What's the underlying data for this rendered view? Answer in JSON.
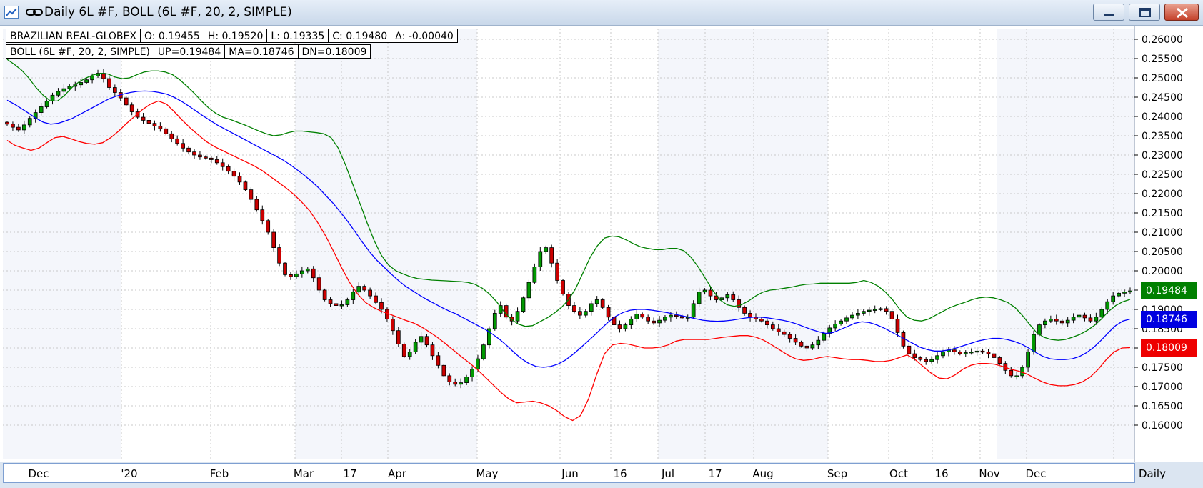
{
  "window": {
    "title": "Daily 6L #F, BOLL (6L #F, 20, 2, SIMPLE)",
    "icons": [
      "chart-app-icon",
      "link-icon",
      "minimize-icon",
      "maximize-icon",
      "close-icon"
    ]
  },
  "info_bar": {
    "row1": [
      "BRAZILIAN REAL-GLOBEX",
      "O: 0.19455",
      "H: 0.19520",
      "L: 0.19335",
      "C: 0.19480",
      "Δ: -0.00040"
    ],
    "row2": [
      "BOLL (6L #F, 20, 2, SIMPLE)",
      "UP=0.19484",
      "MA=0.18746",
      "DN=0.18009"
    ]
  },
  "price_tags": [
    {
      "label": "0.19484",
      "color": "#008000",
      "value": 0.19484
    },
    {
      "label": "0.18746",
      "color": "#0000e0",
      "value": 0.18746
    },
    {
      "label": "0.18009",
      "color": "#ee0000",
      "value": 0.18009
    }
  ],
  "period_label": "Daily",
  "chart_data": {
    "type": "candlestick",
    "y_ticks": [
      "0.26000",
      "0.25500",
      "0.25000",
      "0.24500",
      "0.24000",
      "0.23500",
      "0.23000",
      "0.22500",
      "0.22000",
      "0.21500",
      "0.21000",
      "0.20500",
      "0.20000",
      "0.19500",
      "0.19000",
      "0.18500",
      "0.18000",
      "0.17500",
      "0.17000",
      "0.16500",
      "0.16000"
    ],
    "ylim": [
      0.1595,
      0.2625
    ],
    "x_labels": [
      "Dec",
      "'20",
      "Feb",
      "Mar",
      "17",
      "Apr",
      "May",
      "Jun",
      "16",
      "Jul",
      "17",
      "Aug",
      "Sep",
      "Oct",
      "16",
      "Nov",
      "Dec"
    ],
    "grid": true,
    "colors": {
      "up": "#009900",
      "down": "#cc0000",
      "upper_band": "#008000",
      "mid_band": "#0000ff",
      "lower_band": "#ff0000"
    },
    "close": [
      0.238,
      0.2372,
      0.2365,
      0.2378,
      0.2395,
      0.241,
      0.2425,
      0.244,
      0.2455,
      0.2465,
      0.2472,
      0.2478,
      0.2482,
      0.2488,
      0.2495,
      0.2505,
      0.2512,
      0.2498,
      0.2475,
      0.2462,
      0.2448,
      0.243,
      0.2412,
      0.2398,
      0.239,
      0.2382,
      0.2375,
      0.2368,
      0.2355,
      0.2342,
      0.233,
      0.2318,
      0.2308,
      0.23,
      0.2295,
      0.2292,
      0.2288,
      0.228,
      0.227,
      0.2258,
      0.2245,
      0.223,
      0.221,
      0.2185,
      0.2158,
      0.213,
      0.21,
      0.206,
      0.202,
      0.199,
      0.1985,
      0.1992,
      0.2,
      0.2005,
      0.1982,
      0.195,
      0.1925,
      0.1915,
      0.191,
      0.1912,
      0.1925,
      0.1945,
      0.196,
      0.195,
      0.1935,
      0.1918,
      0.19,
      0.1875,
      0.1845,
      0.181,
      0.1778,
      0.179,
      0.1815,
      0.183,
      0.1808,
      0.178,
      0.1755,
      0.1728,
      0.1712,
      0.1706,
      0.171,
      0.1725,
      0.1745,
      0.1772,
      0.1808,
      0.185,
      0.189,
      0.191,
      0.188,
      0.187,
      0.1895,
      0.193,
      0.197,
      0.201,
      0.205,
      0.206,
      0.202,
      0.1975,
      0.194,
      0.191,
      0.1895,
      0.1885,
      0.1895,
      0.1915,
      0.1925,
      0.1905,
      0.188,
      0.186,
      0.185,
      0.186,
      0.1875,
      0.1888,
      0.188,
      0.187,
      0.1865,
      0.1872,
      0.188,
      0.1885,
      0.1882,
      0.1878,
      0.188,
      0.1915,
      0.1945,
      0.195,
      0.1935,
      0.1925,
      0.193,
      0.1938,
      0.1925,
      0.1905,
      0.189,
      0.188,
      0.1875,
      0.187,
      0.186,
      0.185,
      0.1842,
      0.1835,
      0.1825,
      0.1815,
      0.1805,
      0.18,
      0.1808,
      0.182,
      0.1838,
      0.1852,
      0.1862,
      0.187,
      0.1878,
      0.1885,
      0.189,
      0.1895,
      0.1898,
      0.19,
      0.1902,
      0.1895,
      0.1875,
      0.184,
      0.1805,
      0.1785,
      0.1775,
      0.177,
      0.1765,
      0.177,
      0.178,
      0.179,
      0.1795,
      0.179,
      0.1785,
      0.1788,
      0.179,
      0.1792,
      0.179,
      0.1785,
      0.1775,
      0.176,
      0.1742,
      0.1728,
      0.1728,
      0.175,
      0.179,
      0.1835,
      0.186,
      0.187,
      0.1875,
      0.187,
      0.1865,
      0.1872,
      0.188,
      0.1885,
      0.1878,
      0.187,
      0.188,
      0.19,
      0.192,
      0.1935,
      0.1942,
      0.1945,
      0.1948
    ],
    "upper_band": [
      0.2548,
      0.2535,
      0.252,
      0.25,
      0.2475,
      0.2455,
      0.244,
      0.244,
      0.2455,
      0.2475,
      0.249,
      0.25,
      0.2508,
      0.2512,
      0.251,
      0.2502,
      0.2498,
      0.25,
      0.2508,
      0.2515,
      0.2518,
      0.2518,
      0.2515,
      0.2508,
      0.2495,
      0.2478,
      0.246,
      0.244,
      0.2422,
      0.2408,
      0.2398,
      0.2392,
      0.2385,
      0.2378,
      0.237,
      0.2362,
      0.2355,
      0.235,
      0.2352,
      0.2358,
      0.2362,
      0.2362,
      0.236,
      0.2358,
      0.2355,
      0.2345,
      0.2318,
      0.2275,
      0.2225,
      0.2175,
      0.2125,
      0.2078,
      0.204,
      0.2015,
      0.2,
      0.1992,
      0.1985,
      0.198,
      0.1978,
      0.1976,
      0.1975,
      0.1974,
      0.1973,
      0.1972,
      0.197,
      0.1965,
      0.1955,
      0.194,
      0.192,
      0.1895,
      0.1875,
      0.1862,
      0.1856,
      0.1858,
      0.1868,
      0.1878,
      0.189,
      0.1905,
      0.1925,
      0.1955,
      0.1995,
      0.2035,
      0.2065,
      0.2085,
      0.209,
      0.2088,
      0.208,
      0.207,
      0.2062,
      0.2058,
      0.2055,
      0.2055,
      0.2058,
      0.2058,
      0.2052,
      0.2035,
      0.201,
      0.198,
      0.195,
      0.1925,
      0.1912,
      0.1908,
      0.1912,
      0.1922,
      0.1935,
      0.1945,
      0.195,
      0.1952,
      0.1955,
      0.1958,
      0.1962,
      0.1965,
      0.1966,
      0.1968,
      0.1968,
      0.1968,
      0.1968,
      0.1968,
      0.197,
      0.1975,
      0.197,
      0.196,
      0.1945,
      0.1925,
      0.19,
      0.188,
      0.1872,
      0.187,
      0.1875,
      0.1885,
      0.1895,
      0.1905,
      0.1912,
      0.1918,
      0.1925,
      0.193,
      0.1932,
      0.193,
      0.1925,
      0.1918,
      0.1905,
      0.1885,
      0.1862,
      0.184,
      0.1828,
      0.1822,
      0.182,
      0.1822,
      0.1828,
      0.1835,
      0.1845,
      0.1858,
      0.1875,
      0.1895,
      0.191,
      0.192,
      0.1926
    ],
    "mid_band": [
      0.2442,
      0.2432,
      0.242,
      0.2408,
      0.2395,
      0.2385,
      0.238,
      0.2382,
      0.2388,
      0.2395,
      0.2405,
      0.2415,
      0.2425,
      0.2435,
      0.2445,
      0.2452,
      0.2458,
      0.2462,
      0.2465,
      0.2466,
      0.2465,
      0.2462,
      0.2458,
      0.245,
      0.244,
      0.2428,
      0.2415,
      0.2402,
      0.239,
      0.2378,
      0.2368,
      0.2358,
      0.2348,
      0.2338,
      0.2328,
      0.2318,
      0.2308,
      0.2298,
      0.2288,
      0.2276,
      0.2262,
      0.2248,
      0.2232,
      0.2215,
      0.2195,
      0.2175,
      0.2152,
      0.2128,
      0.2102,
      0.2075,
      0.205,
      0.2028,
      0.201,
      0.1992,
      0.1975,
      0.196,
      0.1948,
      0.1936,
      0.1925,
      0.1915,
      0.1905,
      0.1896,
      0.1888,
      0.1878,
      0.1868,
      0.1858,
      0.1848,
      0.1836,
      0.1822,
      0.1806,
      0.1788,
      0.1772,
      0.176,
      0.1752,
      0.175,
      0.1752,
      0.1758,
      0.1768,
      0.1782,
      0.1798,
      0.1815,
      0.1832,
      0.185,
      0.1868,
      0.1882,
      0.1892,
      0.1898,
      0.19,
      0.19,
      0.1898,
      0.1895,
      0.1892,
      0.1888,
      0.1884,
      0.188,
      0.1876,
      0.1872,
      0.187,
      0.1869,
      0.187,
      0.1872,
      0.1875,
      0.1878,
      0.188,
      0.188,
      0.1878,
      0.1875,
      0.1872,
      0.1868,
      0.1862,
      0.1855,
      0.1848,
      0.1842,
      0.1838,
      0.184,
      0.1848,
      0.1856,
      0.1864,
      0.1868,
      0.1866,
      0.186,
      0.1852,
      0.1842,
      0.1832,
      0.1822,
      0.1812,
      0.1802,
      0.1796,
      0.1792,
      0.1792,
      0.1795,
      0.18,
      0.1806,
      0.1812,
      0.1818,
      0.1822,
      0.1825,
      0.1825,
      0.1822,
      0.1817,
      0.181,
      0.18,
      0.1788,
      0.1778,
      0.1772,
      0.177,
      0.177,
      0.1772,
      0.1778,
      0.1788,
      0.1802,
      0.182,
      0.184,
      0.1858,
      0.187,
      0.1875
    ],
    "lower_band": [
      0.2338,
      0.2325,
      0.2318,
      0.2312,
      0.2318,
      0.2332,
      0.2345,
      0.2348,
      0.2342,
      0.2335,
      0.233,
      0.2328,
      0.2332,
      0.2345,
      0.2362,
      0.2382,
      0.24,
      0.2418,
      0.2432,
      0.244,
      0.2432,
      0.2412,
      0.239,
      0.237,
      0.2352,
      0.2335,
      0.2322,
      0.2312,
      0.2302,
      0.2292,
      0.2282,
      0.2272,
      0.226,
      0.2245,
      0.223,
      0.2215,
      0.2198,
      0.2178,
      0.2155,
      0.2125,
      0.209,
      0.205,
      0.2008,
      0.197,
      0.194,
      0.1918,
      0.1905,
      0.1895,
      0.1888,
      0.188,
      0.1872,
      0.1865,
      0.1855,
      0.1842,
      0.1828,
      0.1812,
      0.1795,
      0.1778,
      0.1762,
      0.1745,
      0.1725,
      0.1705,
      0.1685,
      0.1668,
      0.1658,
      0.166,
      0.1662,
      0.1658,
      0.165,
      0.1638,
      0.1622,
      0.1612,
      0.1625,
      0.1668,
      0.173,
      0.1785,
      0.1808,
      0.1812,
      0.181,
      0.1805,
      0.18,
      0.18,
      0.1802,
      0.1808,
      0.1818,
      0.1822,
      0.1822,
      0.1822,
      0.1822,
      0.1825,
      0.1828,
      0.183,
      0.1832,
      0.1832,
      0.1828,
      0.182,
      0.1808,
      0.1795,
      0.1782,
      0.1772,
      0.1768,
      0.177,
      0.1775,
      0.1778,
      0.1775,
      0.1772,
      0.177,
      0.177,
      0.1768,
      0.1765,
      0.1765,
      0.1768,
      0.1775,
      0.1782,
      0.177,
      0.1752,
      0.1735,
      0.1722,
      0.172,
      0.173,
      0.1745,
      0.1755,
      0.176,
      0.176,
      0.1758,
      0.1752,
      0.1745,
      0.174,
      0.1733,
      0.1722,
      0.1712,
      0.1705,
      0.1702,
      0.1702,
      0.1705,
      0.1712,
      0.1725,
      0.1745,
      0.177,
      0.179,
      0.18,
      0.1801
    ]
  }
}
